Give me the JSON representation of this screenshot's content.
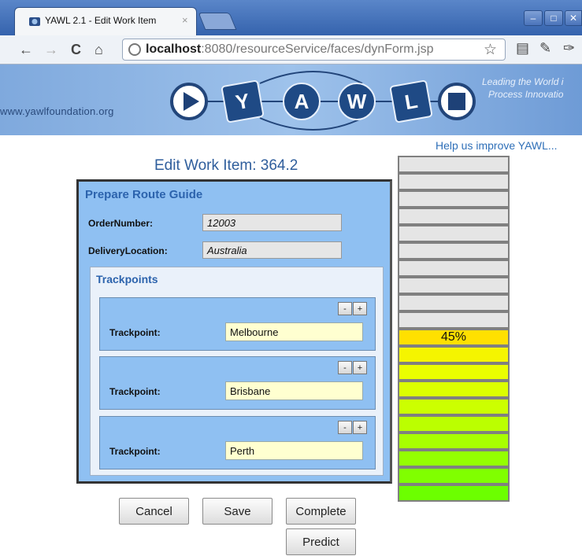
{
  "browser": {
    "tab_title": "YAWL 2.1 - Edit Work Item",
    "tab_close": "×",
    "url_host": "localhost",
    "url_rest": ":8080/resourceService/faces/dynForm.jsp"
  },
  "banner": {
    "site": "www.yawlfoundation.org",
    "tagline_1": "Leading the World i",
    "tagline_2": "Process Innovatio",
    "logo_letters": [
      "Y",
      "A",
      "W",
      "L"
    ]
  },
  "help_link": "Help us improve YAWL...",
  "page_title": "Edit Work Item: 364.2",
  "form": {
    "title": "Prepare Route Guide",
    "fields": [
      {
        "label": "OrderNumber:",
        "value": "12003"
      },
      {
        "label": "DeliveryLocation:",
        "value": "Australia"
      }
    ],
    "trackpoints": {
      "title": "Trackpoints",
      "items": [
        {
          "label": "Trackpoint:",
          "value": "Melbourne"
        },
        {
          "label": "Trackpoint:",
          "value": "Brisbane"
        },
        {
          "label": "Trackpoint:",
          "value": "Perth"
        }
      ],
      "minus_label": "-",
      "plus_label": "+"
    }
  },
  "buttons": {
    "cancel": "Cancel",
    "save": "Save",
    "complete": "Complete",
    "predict": "Predict"
  },
  "progress": {
    "label": "45%",
    "value_percent": 45,
    "segments_total": 20,
    "filled_colors": [
      "#ffe000",
      "#f5f500",
      "#eaff00",
      "#dcff00",
      "#ccff00",
      "#bbff00",
      "#a8ff00",
      "#94ff00",
      "#80ff00",
      "#6cff00"
    ],
    "empty_color": "#e5e5e5"
  }
}
